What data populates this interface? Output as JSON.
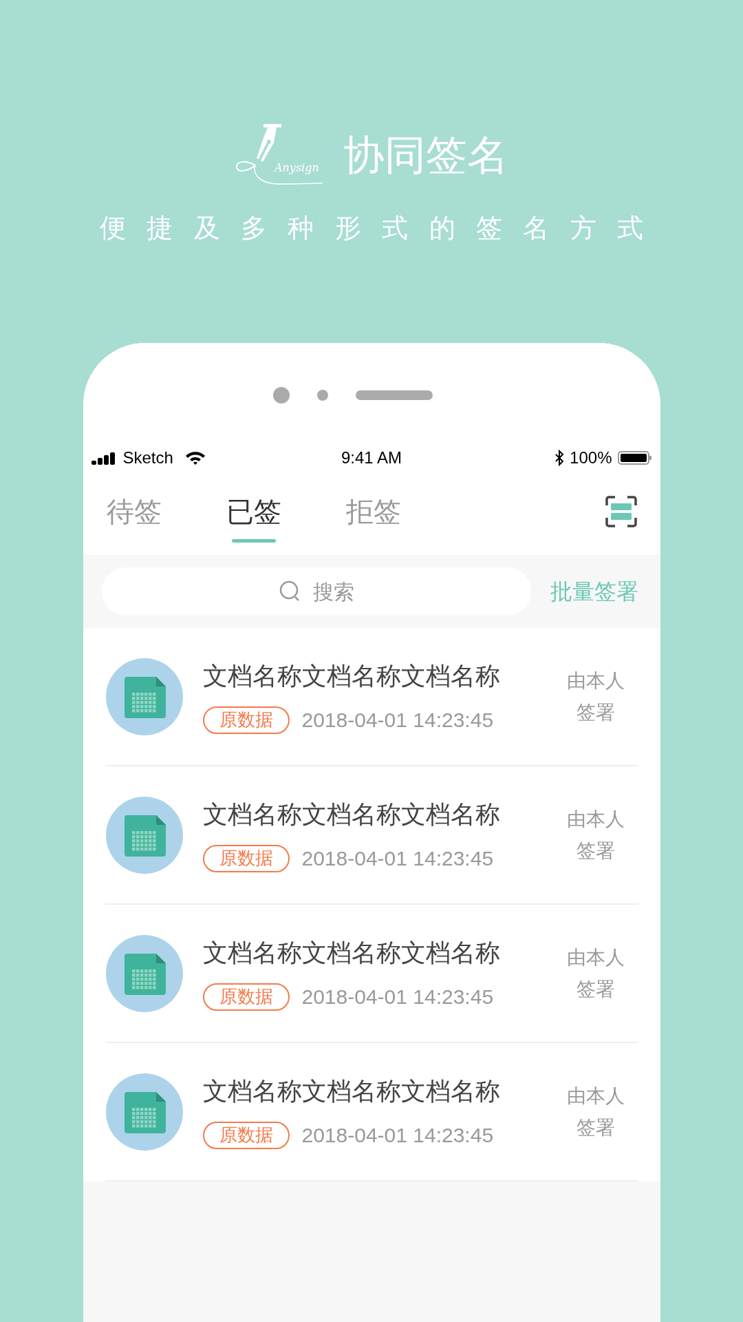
{
  "header": {
    "logo_text": "Anysign",
    "title": "协同签名",
    "subtitle": "便捷及多种形式的签名方式"
  },
  "status_bar": {
    "carrier": "Sketch",
    "time": "9:41 AM",
    "battery": "100%"
  },
  "tabs": [
    {
      "label": "待签",
      "selected": false
    },
    {
      "label": "已签",
      "selected": true
    },
    {
      "label": "拒签",
      "selected": false
    }
  ],
  "search": {
    "placeholder": "搜索"
  },
  "batch_button": "批量签署",
  "documents": [
    {
      "title": "文档名称文档名称文档名称",
      "tag": "原数据",
      "time": "2018-04-01 14:23:45",
      "signer": "由本人签署"
    },
    {
      "title": "文档名称文档名称文档名称",
      "tag": "原数据",
      "time": "2018-04-01 14:23:45",
      "signer": "由本人签署"
    },
    {
      "title": "文档名称文档名称文档名称",
      "tag": "原数据",
      "time": "2018-04-01 14:23:45",
      "signer": "由本人签署"
    },
    {
      "title": "文档名称文档名称文档名称",
      "tag": "原数据",
      "time": "2018-04-01 14:23:45",
      "signer": "由本人签署"
    }
  ]
}
